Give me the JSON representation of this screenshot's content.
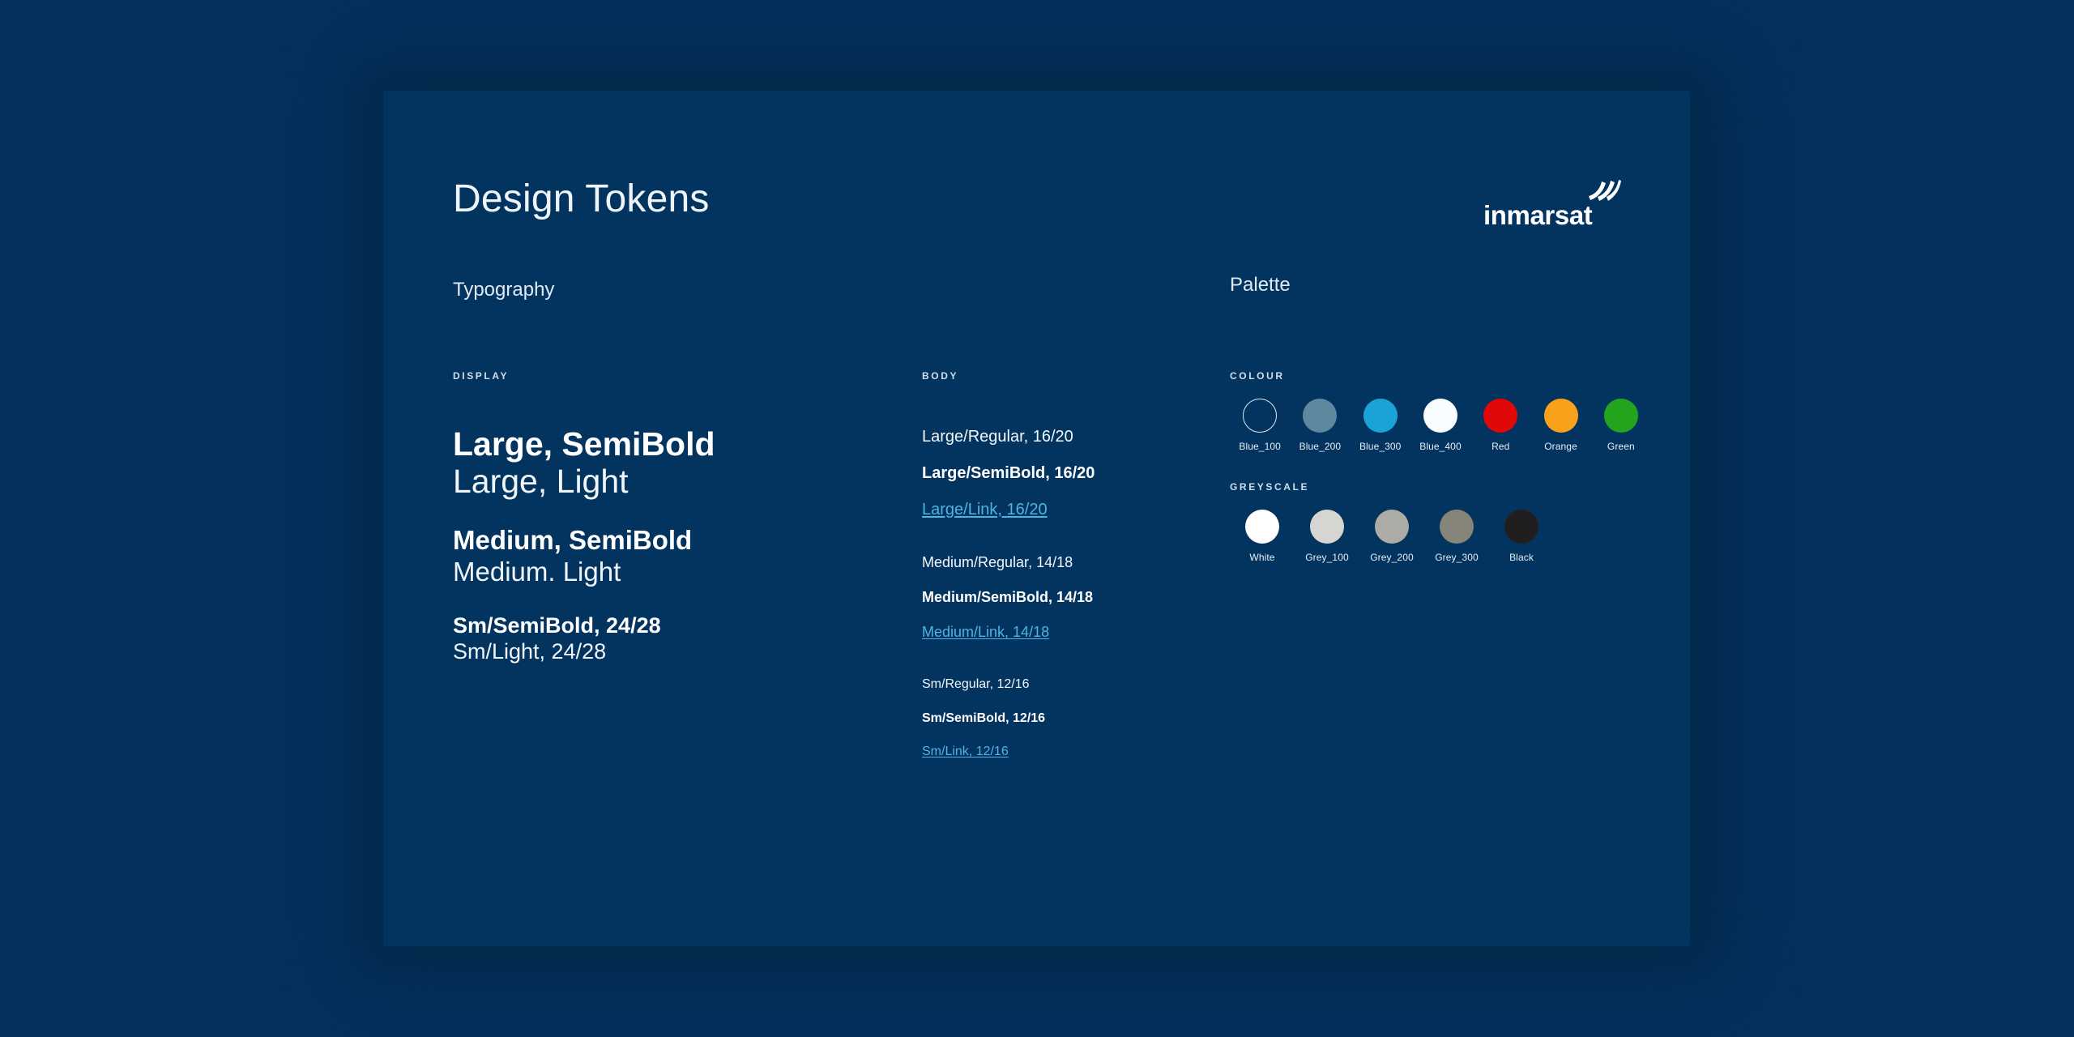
{
  "page": {
    "title": "Design Tokens",
    "background_color": "#04305c",
    "card_color": "#033460"
  },
  "logo": {
    "wordmark": "inmarsat",
    "icon": "signal-waves-icon"
  },
  "typography": {
    "heading": "Typography",
    "display": {
      "eyebrow": "DISPLAY",
      "groups": [
        {
          "semibold": "Large, SemiBold",
          "light": "Large, Light"
        },
        {
          "semibold": "Medium, SemiBold",
          "light": "Medium. Light"
        },
        {
          "semibold": "Sm/SemiBold, 24/28",
          "light": "Sm/Light, 24/28"
        }
      ]
    },
    "body": {
      "eyebrow": "BODY",
      "groups": [
        {
          "regular": "Large/Regular, 16/20",
          "semibold": "Large/SemiBold, 16/20",
          "link": "Large/Link, 16/20"
        },
        {
          "regular": "Medium/Regular, 14/18",
          "semibold": "Medium/SemiBold, 14/18",
          "link": "Medium/Link, 14/18"
        },
        {
          "regular": "Sm/Regular, 12/16",
          "semibold": "Sm/SemiBold, 12/16",
          "link": "Sm/Link, 12/16"
        }
      ]
    }
  },
  "palette": {
    "heading": "Palette",
    "colour": {
      "eyebrow": "COLOUR",
      "swatches": [
        {
          "label": "Blue_100",
          "hex": "#033460",
          "outlined": true
        },
        {
          "label": "Blue_200",
          "hex": "#5e88a0",
          "outlined": false
        },
        {
          "label": "Blue_300",
          "hex": "#1ba3d6",
          "outlined": false
        },
        {
          "label": "Blue_400",
          "hex": "#fafdff",
          "outlined": false
        },
        {
          "label": "Red",
          "hex": "#e00808",
          "outlined": false
        },
        {
          "label": "Orange",
          "hex": "#f9a11b",
          "outlined": false
        },
        {
          "label": "Green",
          "hex": "#22a41d",
          "outlined": false
        }
      ]
    },
    "greyscale": {
      "eyebrow": "GREYSCALE",
      "swatches": [
        {
          "label": "White",
          "hex": "#ffffff",
          "outlined": false
        },
        {
          "label": "Grey_100",
          "hex": "#d5d6d2",
          "outlined": false
        },
        {
          "label": "Grey_200",
          "hex": "#aaaca5",
          "outlined": false
        },
        {
          "label": "Grey_300",
          "hex": "#87857a",
          "outlined": false
        },
        {
          "label": "Black",
          "hex": "#201f1d",
          "outlined": false
        }
      ]
    }
  }
}
